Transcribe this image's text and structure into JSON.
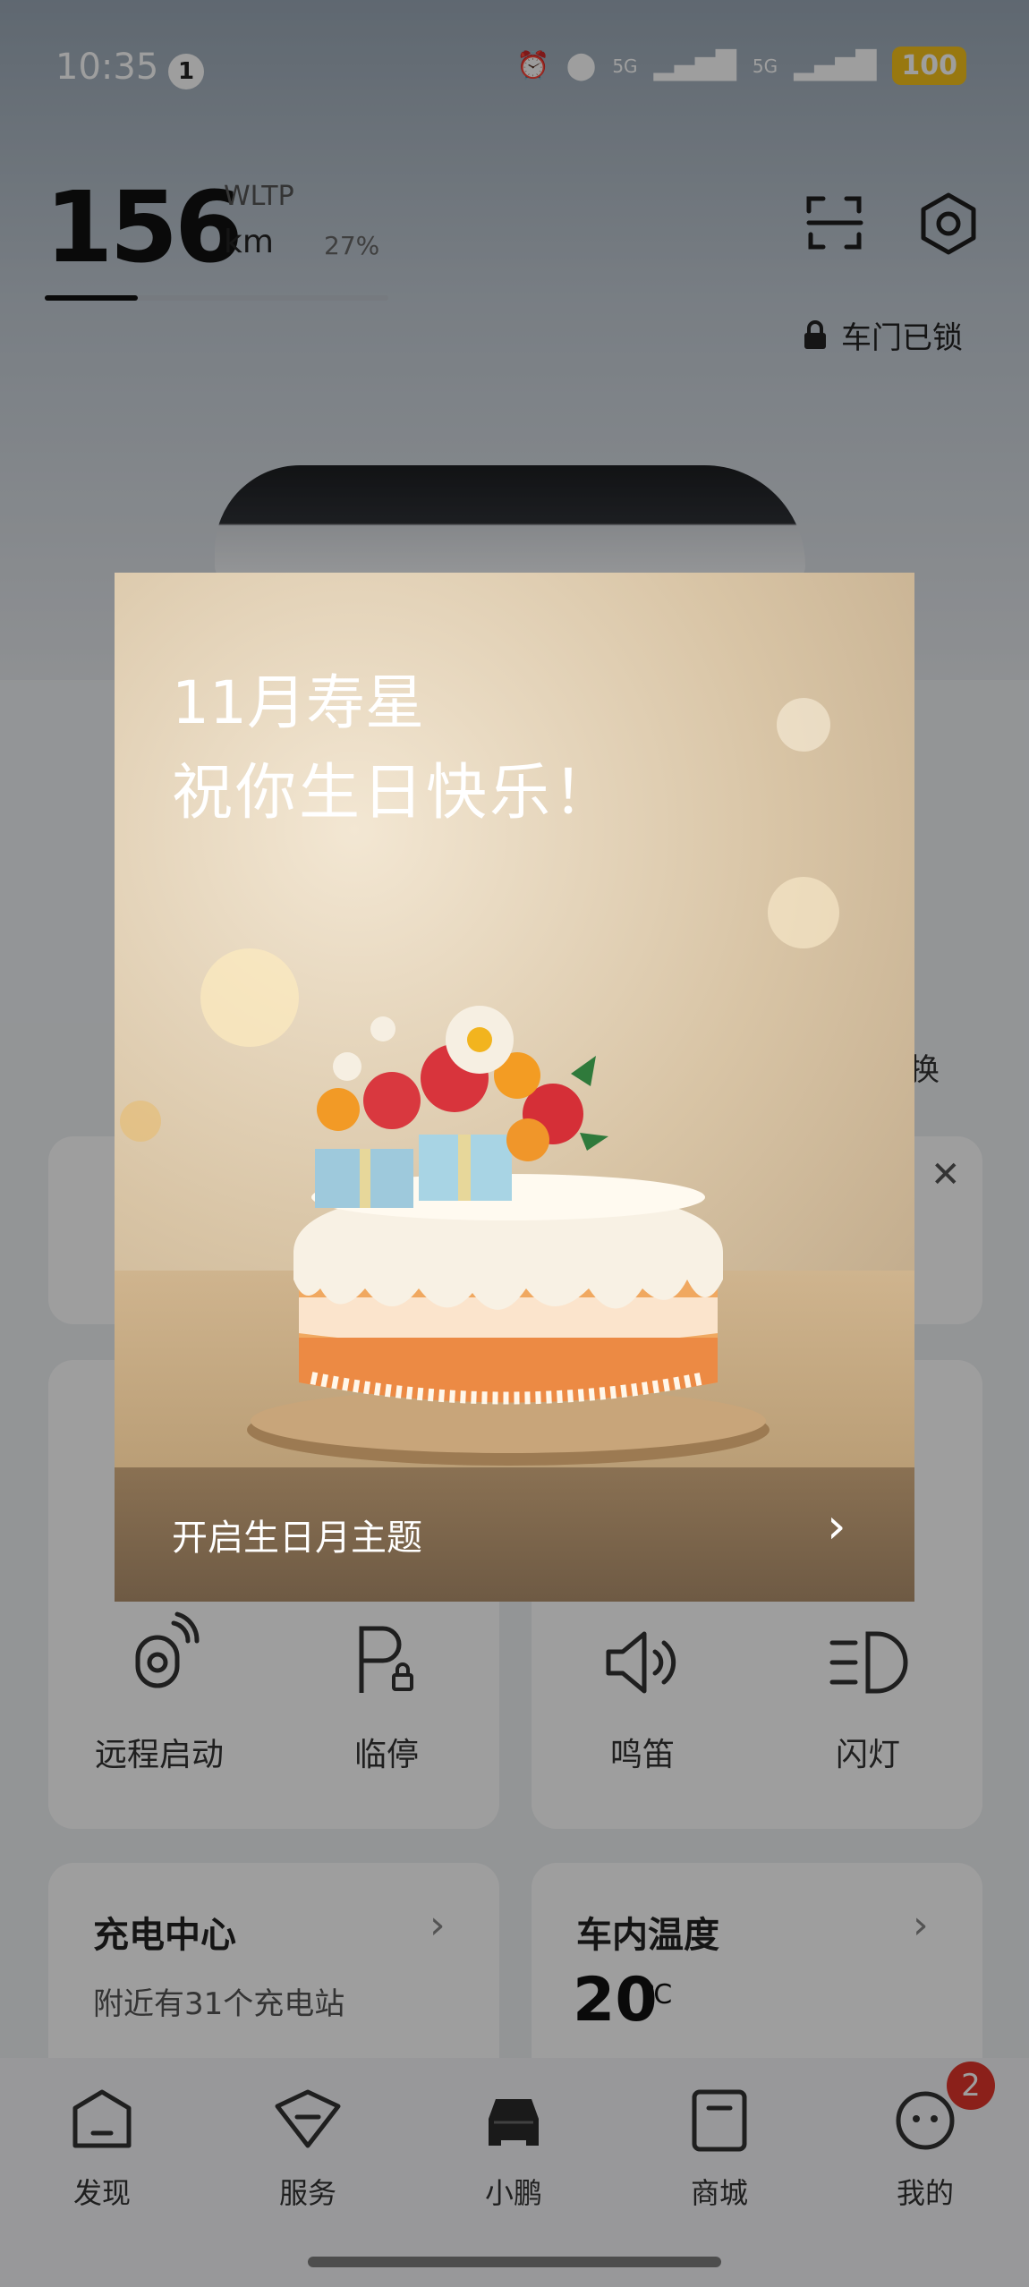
{
  "status_bar": {
    "time": "10:35",
    "notification_count": "1",
    "network_1": "5G",
    "network_2": "5G",
    "battery": "100"
  },
  "vehicle": {
    "range_value": "156",
    "range_standard": "WLTP",
    "range_unit": "km",
    "battery_percent": "27%",
    "battery_level": 0.27,
    "door_status": "车门已锁"
  },
  "background_cards": {
    "partial_right_text": "换",
    "controls": [
      {
        "label": "远程启动",
        "icon": "remote-start-icon"
      },
      {
        "label": "临停",
        "icon": "temporary-parking-icon"
      },
      {
        "label": "鸣笛",
        "icon": "horn-icon"
      },
      {
        "label": "闪灯",
        "icon": "flash-lights-icon"
      }
    ],
    "charging": {
      "title": "充电中心",
      "subtitle": "附近有31个充电站"
    },
    "cabin_temp": {
      "title": "车内温度",
      "value": "20",
      "unit": "℃"
    }
  },
  "popup": {
    "title_line1": "11月寿星",
    "title_line2": "祝你生日快乐！",
    "action_label": "开启生日月主题"
  },
  "tabbar": {
    "tabs": [
      {
        "label": "发现",
        "icon": "discover-icon"
      },
      {
        "label": "服务",
        "icon": "service-icon"
      },
      {
        "label": "小鹏",
        "icon": "car-icon"
      },
      {
        "label": "商城",
        "icon": "mall-icon"
      },
      {
        "label": "我的",
        "icon": "profile-icon"
      }
    ],
    "profile_badge": "2"
  },
  "colors": {
    "battery_badge": "#f5c21b",
    "notification_badge": "#e0352b"
  }
}
